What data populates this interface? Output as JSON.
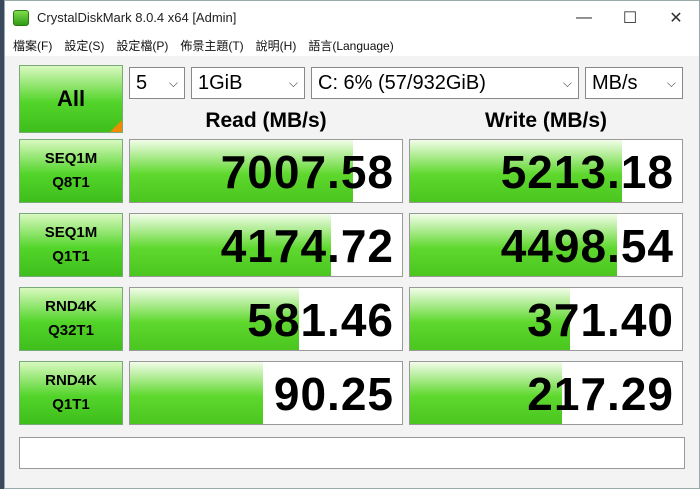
{
  "window": {
    "title": "CrystalDiskMark 8.0.4 x64 [Admin]"
  },
  "menu": [
    "檔案(F)",
    "設定(S)",
    "設定檔(P)",
    "佈景主題(T)",
    "說明(H)",
    "語言(Language)"
  ],
  "controls": {
    "all_label": "All",
    "count": "5",
    "size": "1GiB",
    "drive": "C: 6% (57/932GiB)",
    "unit": "MB/s"
  },
  "headers": {
    "read": "Read (MB/s)",
    "write": "Write (MB/s)"
  },
  "tests": [
    {
      "line1": "SEQ1M",
      "line2": "Q8T1",
      "read": "7007.58",
      "write": "5213.18",
      "read_fill": 0.82,
      "write_fill": 0.78
    },
    {
      "line1": "SEQ1M",
      "line2": "Q1T1",
      "read": "4174.72",
      "write": "4498.54",
      "read_fill": 0.74,
      "write_fill": 0.76
    },
    {
      "line1": "RND4K",
      "line2": "Q32T1",
      "read": "581.46",
      "write": "371.40",
      "read_fill": 0.62,
      "write_fill": 0.59
    },
    {
      "line1": "RND4K",
      "line2": "Q1T1",
      "read": "90.25",
      "write": "217.29",
      "read_fill": 0.49,
      "write_fill": 0.56
    }
  ],
  "comment": ""
}
